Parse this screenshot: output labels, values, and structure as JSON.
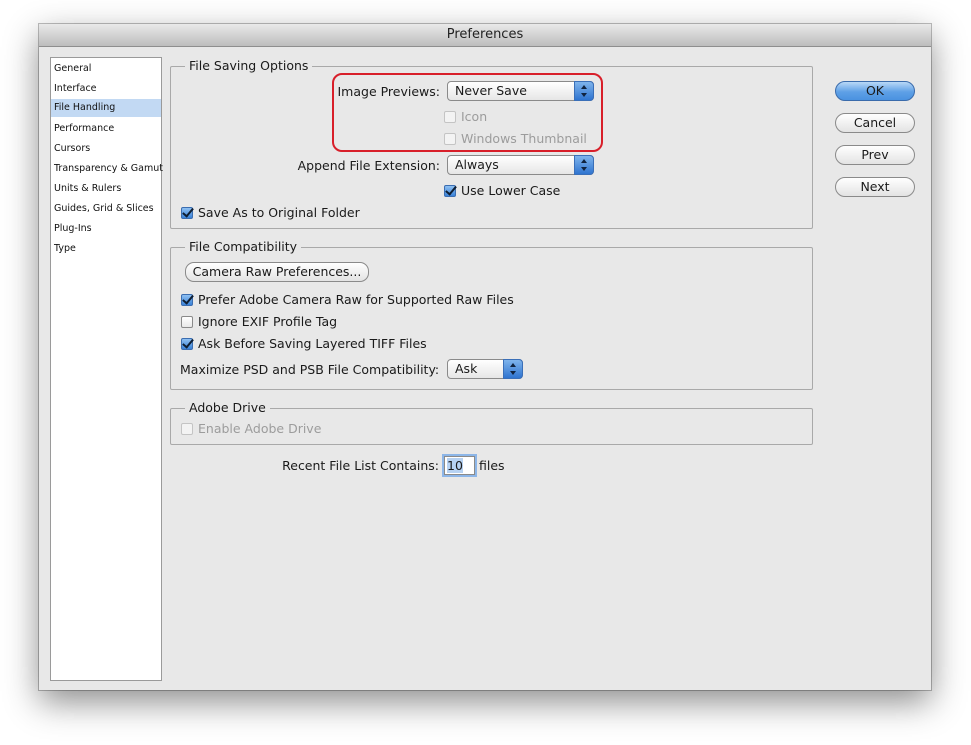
{
  "window": {
    "title": "Preferences"
  },
  "sidebar": {
    "items": [
      {
        "label": "General",
        "selected": false
      },
      {
        "label": "Interface",
        "selected": false
      },
      {
        "label": "File Handling",
        "selected": true
      },
      {
        "label": "Performance",
        "selected": false
      },
      {
        "label": "Cursors",
        "selected": false
      },
      {
        "label": "Transparency & Gamut",
        "selected": false
      },
      {
        "label": "Units & Rulers",
        "selected": false
      },
      {
        "label": "Guides, Grid & Slices",
        "selected": false
      },
      {
        "label": "Plug-Ins",
        "selected": false
      },
      {
        "label": "Type",
        "selected": false
      }
    ]
  },
  "file_saving": {
    "title": "File Saving Options",
    "image_previews_label": "Image Previews:",
    "image_previews_value": "Never Save",
    "icon_label": "Icon",
    "windows_thumbnail_label": "Windows Thumbnail",
    "append_ext_label": "Append File Extension:",
    "append_ext_value": "Always",
    "use_lower_case_label": "Use Lower Case",
    "save_as_original_label": "Save As to Original Folder"
  },
  "file_compat": {
    "title": "File Compatibility",
    "camera_raw_button": "Camera Raw Preferences...",
    "prefer_acr_label": "Prefer Adobe Camera Raw for Supported Raw Files",
    "ignore_exif_label": "Ignore EXIF Profile Tag",
    "ask_tiff_label": "Ask Before Saving Layered TIFF Files",
    "maximize_label": "Maximize PSD and PSB File Compatibility:",
    "maximize_value": "Ask"
  },
  "adobe_drive": {
    "title": "Adobe Drive",
    "enable_label": "Enable Adobe Drive"
  },
  "recent_files": {
    "label": "Recent File List Contains:",
    "value": "10",
    "suffix": "files"
  },
  "buttons": {
    "ok": "OK",
    "cancel": "Cancel",
    "prev": "Prev",
    "next": "Next"
  },
  "colors": {
    "highlight": "#d81f2a",
    "selection": "#c2d9f3",
    "accent": "#4a92e0"
  }
}
